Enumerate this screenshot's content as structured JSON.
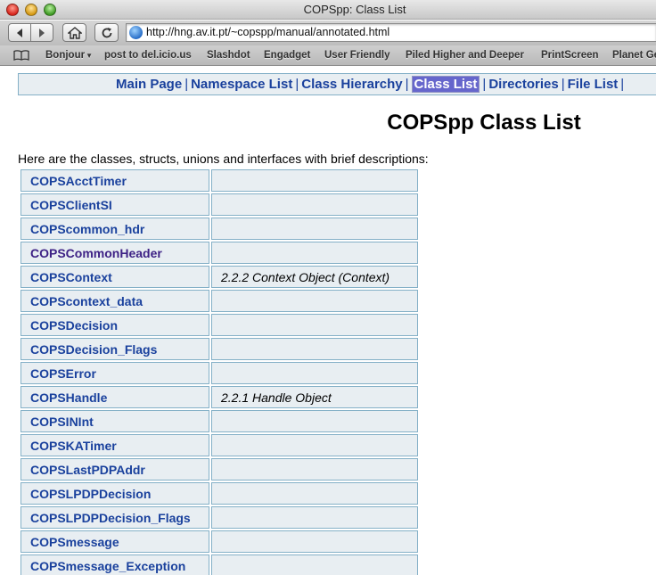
{
  "window": {
    "title": "COPSpp: Class List"
  },
  "toolbar": {
    "url": "http://hng.av.it.pt/~copspp/manual/annotated.html"
  },
  "bookmarks": [
    {
      "label": "Bonjour",
      "has_menu": true
    },
    {
      "label": "post to del.icio.us"
    },
    {
      "label": "Slashdot"
    },
    {
      "label": "Engadget"
    },
    {
      "label": "User Friendly"
    },
    {
      "label": "Piled Higher and Deeper"
    },
    {
      "label": "PrintScreen"
    },
    {
      "label": "Planet Ge"
    }
  ],
  "nav": {
    "items": [
      "Main Page",
      "Namespace List",
      "Class Hierarchy",
      "Class List",
      "Directories",
      "File List"
    ],
    "separator": "|",
    "current": "Class List"
  },
  "page": {
    "title": "COPSpp Class List",
    "intro": "Here are the classes, structs, unions and interfaces with brief descriptions:"
  },
  "classes": [
    {
      "name": "COPSAcctTimer",
      "desc": ""
    },
    {
      "name": "COPSClientSI",
      "desc": ""
    },
    {
      "name": "COPScommon_hdr",
      "desc": ""
    },
    {
      "name": "COPSCommonHeader",
      "desc": "",
      "visited": true
    },
    {
      "name": "COPSContext",
      "desc": "2.2.2 Context Object (Context)"
    },
    {
      "name": "COPScontext_data",
      "desc": ""
    },
    {
      "name": "COPSDecision",
      "desc": ""
    },
    {
      "name": "COPSDecision_Flags",
      "desc": ""
    },
    {
      "name": "COPSError",
      "desc": ""
    },
    {
      "name": "COPSHandle",
      "desc": "2.2.1 Handle Object"
    },
    {
      "name": "COPSINInt",
      "desc": ""
    },
    {
      "name": "COPSKATimer",
      "desc": ""
    },
    {
      "name": "COPSLastPDPAddr",
      "desc": ""
    },
    {
      "name": "COPSLPDPDecision",
      "desc": ""
    },
    {
      "name": "COPSLPDPDecision_Flags",
      "desc": ""
    },
    {
      "name": "COPSmessage",
      "desc": ""
    },
    {
      "name": "COPSmessage_Exception",
      "desc": ""
    }
  ],
  "colors": {
    "link": "#1a419d",
    "visited_link": "#3d2185",
    "cell_bg": "#e8eef2",
    "cell_border": "#84b0c7",
    "current_tab_bg": "#6666cc"
  }
}
